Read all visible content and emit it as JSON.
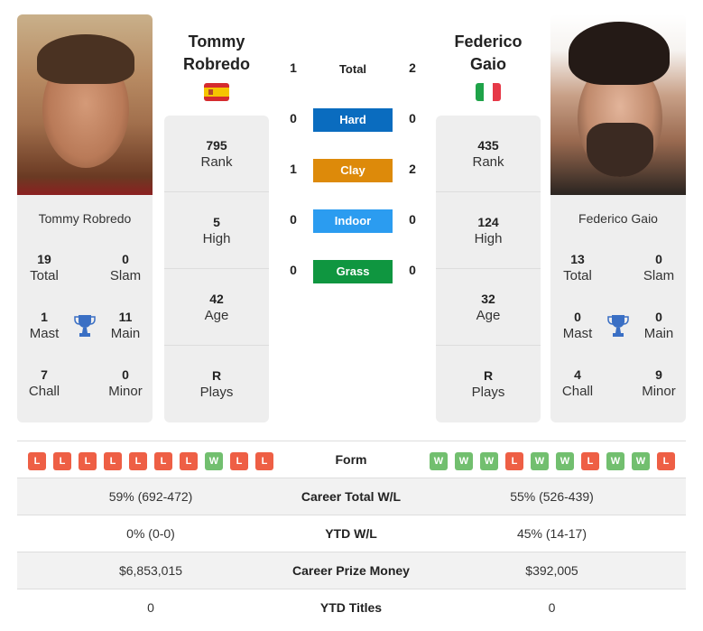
{
  "players": {
    "left": {
      "name_line1": "Tommy",
      "name_line2": "Robredo",
      "full_name": "Tommy Robredo",
      "country": "Spain",
      "flag_icon": "flag-spain-icon",
      "titles": {
        "total": {
          "value": "19",
          "label": "Total"
        },
        "slam": {
          "value": "0",
          "label": "Slam"
        },
        "mast": {
          "value": "1",
          "label": "Mast"
        },
        "main": {
          "value": "11",
          "label": "Main"
        },
        "chall": {
          "value": "7",
          "label": "Chall"
        },
        "minor": {
          "value": "0",
          "label": "Minor"
        }
      },
      "info": [
        {
          "value": "795",
          "label": "Rank"
        },
        {
          "value": "5",
          "label": "High"
        },
        {
          "value": "42",
          "label": "Age"
        },
        {
          "value": "R",
          "label": "Plays"
        }
      ],
      "form": [
        "L",
        "L",
        "L",
        "L",
        "L",
        "L",
        "L",
        "W",
        "L",
        "L"
      ]
    },
    "right": {
      "name_line1": "Federico",
      "name_line2": "Gaio",
      "full_name": "Federico Gaio",
      "country": "Italy",
      "flag_icon": "flag-italy-icon",
      "titles": {
        "total": {
          "value": "13",
          "label": "Total"
        },
        "slam": {
          "value": "0",
          "label": "Slam"
        },
        "mast": {
          "value": "0",
          "label": "Mast"
        },
        "main": {
          "value": "0",
          "label": "Main"
        },
        "chall": {
          "value": "4",
          "label": "Chall"
        },
        "minor": {
          "value": "9",
          "label": "Minor"
        }
      },
      "info": [
        {
          "value": "435",
          "label": "Rank"
        },
        {
          "value": "124",
          "label": "High"
        },
        {
          "value": "32",
          "label": "Age"
        },
        {
          "value": "R",
          "label": "Plays"
        }
      ],
      "form": [
        "W",
        "W",
        "W",
        "L",
        "W",
        "W",
        "L",
        "W",
        "W",
        "L"
      ]
    }
  },
  "h2h": {
    "total": {
      "label": "Total",
      "left": "1",
      "right": "2"
    },
    "surfaces": [
      {
        "label": "Hard",
        "left": "0",
        "right": "0",
        "color": "#0a6cbf"
      },
      {
        "label": "Clay",
        "left": "1",
        "right": "2",
        "color": "#dd8a0a"
      },
      {
        "label": "Indoor",
        "left": "0",
        "right": "0",
        "color": "#2b9cf0"
      },
      {
        "label": "Grass",
        "left": "0",
        "right": "0",
        "color": "#0f9640"
      }
    ]
  },
  "comparison": {
    "form_label": "Form",
    "rows": [
      {
        "label": "Career Total W/L",
        "left": "59% (692-472)",
        "right": "55% (526-439)"
      },
      {
        "label": "YTD W/L",
        "left": "0% (0-0)",
        "right": "45% (14-17)"
      },
      {
        "label": "Career Prize Money",
        "left": "$6,853,015",
        "right": "$392,005"
      },
      {
        "label": "YTD Titles",
        "left": "0",
        "right": "0"
      }
    ]
  }
}
